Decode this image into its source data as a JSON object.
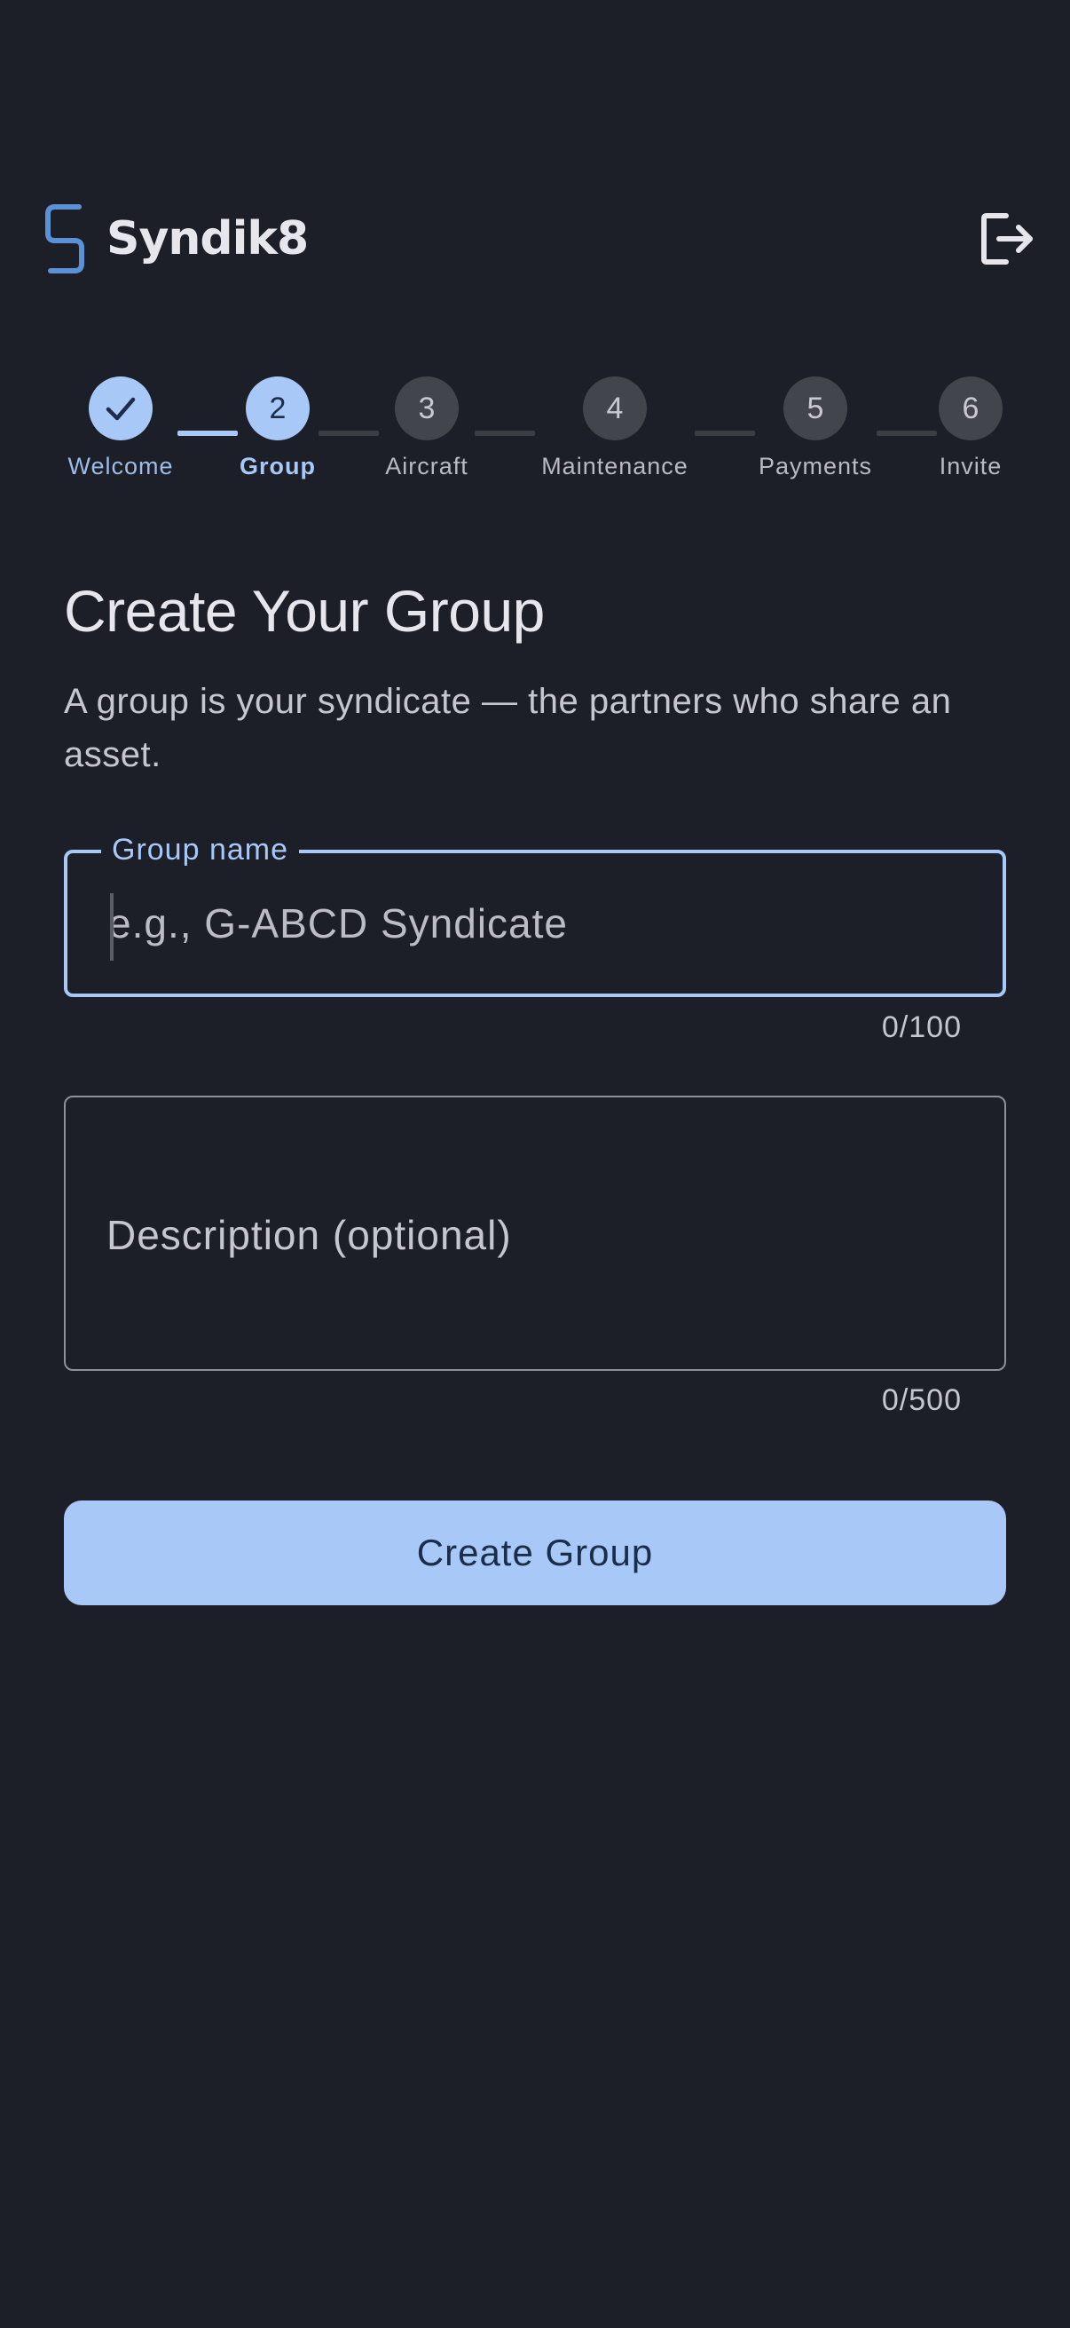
{
  "app": {
    "name": "Syndik8",
    "logo_icon": "syndik8-logo-icon",
    "logout_icon": "logout-icon"
  },
  "colors": {
    "background": "#1d1f28",
    "accent": "#a8c8f8",
    "inactive_step": "#43454d"
  },
  "stepper": {
    "current_step": 2,
    "steps": [
      {
        "number": "1",
        "label": "Welcome",
        "status": "done",
        "icon": "checkmark-icon"
      },
      {
        "number": "2",
        "label": "Group",
        "status": "active"
      },
      {
        "number": "3",
        "label": "Aircraft",
        "status": "upcoming"
      },
      {
        "number": "4",
        "label": "Maintenance",
        "status": "upcoming"
      },
      {
        "number": "5",
        "label": "Payments",
        "status": "upcoming"
      },
      {
        "number": "6",
        "label": "Invite",
        "status": "upcoming"
      }
    ]
  },
  "form": {
    "title": "Create Your Group",
    "subtitle": "A group is your syndicate — the partners who share an asset.",
    "group_name": {
      "label": "Group name",
      "placeholder": "e.g., G-ABCD Syndicate",
      "value": "",
      "counter": "0/100"
    },
    "description": {
      "placeholder": "Description (optional)",
      "value": "",
      "counter": "0/500"
    },
    "submit_label": "Create Group"
  }
}
